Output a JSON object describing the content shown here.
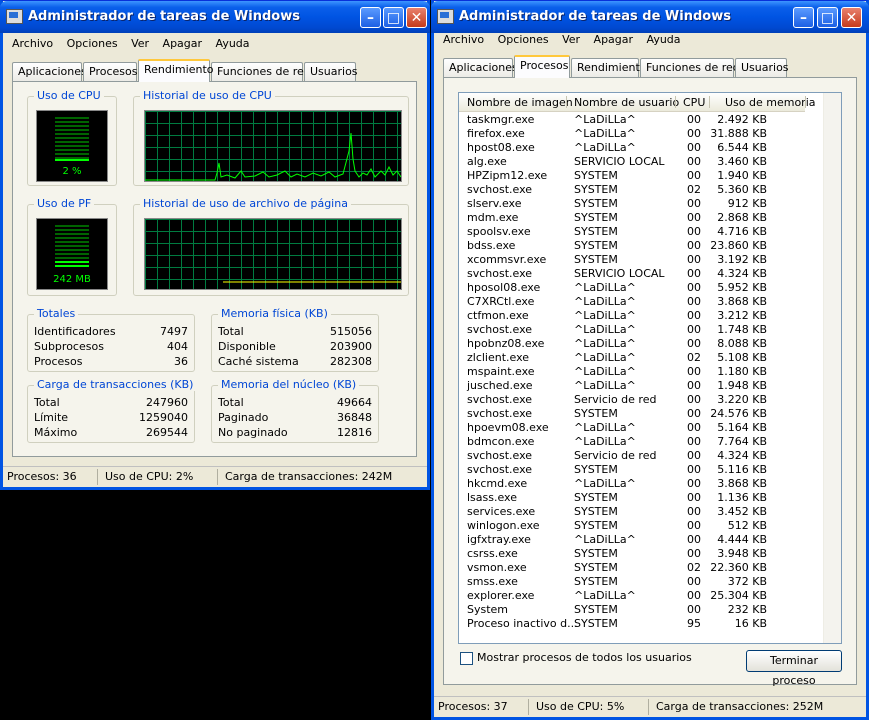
{
  "window1": {
    "title": "Administrador de tareas de Windows",
    "menu": [
      "Archivo",
      "Opciones",
      "Ver",
      "Apagar",
      "Ayuda"
    ],
    "tabs": [
      "Aplicaciones",
      "Procesos",
      "Rendimiento",
      "Funciones de red",
      "Usuarios"
    ],
    "active_tab": "Rendimiento",
    "cpu_usage": {
      "title": "Uso de CPU",
      "value": "2 %",
      "level": 0.02
    },
    "cpu_history": {
      "title": "Historial de uso de CPU"
    },
    "pf_usage": {
      "title": "Uso de PF",
      "value": "242 MB",
      "level": 0.19
    },
    "pf_history": {
      "title": "Historial de uso de archivo de página"
    },
    "totales": {
      "title": "Totales",
      "rows": [
        {
          "label": "Identificadores",
          "value": "7497"
        },
        {
          "label": "Subprocesos",
          "value": "404"
        },
        {
          "label": "Procesos",
          "value": "36"
        }
      ]
    },
    "memoria_fisica": {
      "title": "Memoria física (KB)",
      "rows": [
        {
          "label": "Total",
          "value": "515056"
        },
        {
          "label": "Disponible",
          "value": "203900"
        },
        {
          "label": "Caché sistema",
          "value": "282308"
        }
      ]
    },
    "carga_transacciones": {
      "title": "Carga de transacciones (KB)",
      "rows": [
        {
          "label": "Total",
          "value": "247960"
        },
        {
          "label": "Límite",
          "value": "1259040"
        },
        {
          "label": "Máximo",
          "value": "269544"
        }
      ]
    },
    "memoria_nucleo": {
      "title": "Memoria del núcleo (KB)",
      "rows": [
        {
          "label": "Total",
          "value": "49664"
        },
        {
          "label": "Paginado",
          "value": "36848"
        },
        {
          "label": "No paginado",
          "value": "12816"
        }
      ]
    },
    "status": {
      "procesos": "Procesos: 36",
      "cpu": "Uso de CPU: 2%",
      "carga": "Carga de transacciones: 242M"
    }
  },
  "window2": {
    "title": "Administrador de tareas de Windows",
    "menu": [
      "Archivo",
      "Opciones",
      "Ver",
      "Apagar",
      "Ayuda"
    ],
    "tabs": [
      "Aplicaciones",
      "Procesos",
      "Rendimiento",
      "Funciones de red",
      "Usuarios"
    ],
    "active_tab": "Procesos",
    "columns": [
      "Nombre de imagen",
      "Nombre de usuario",
      "CPU",
      "Uso de memoria"
    ],
    "processes": [
      [
        "taskmgr.exe",
        "^LaDiLLa^",
        "00",
        "2.492 KB"
      ],
      [
        "firefox.exe",
        "^LaDiLLa^",
        "00",
        "31.888 KB"
      ],
      [
        "hpost08.exe",
        "^LaDiLLa^",
        "00",
        "6.544 KB"
      ],
      [
        "alg.exe",
        "SERVICIO LOCAL",
        "00",
        "3.460 KB"
      ],
      [
        "HPZipm12.exe",
        "SYSTEM",
        "00",
        "1.940 KB"
      ],
      [
        "svchost.exe",
        "SYSTEM",
        "02",
        "5.360 KB"
      ],
      [
        "slserv.exe",
        "SYSTEM",
        "00",
        "912 KB"
      ],
      [
        "mdm.exe",
        "SYSTEM",
        "00",
        "2.868 KB"
      ],
      [
        "spoolsv.exe",
        "SYSTEM",
        "00",
        "4.716 KB"
      ],
      [
        "bdss.exe",
        "SYSTEM",
        "00",
        "23.860 KB"
      ],
      [
        "xcommsvr.exe",
        "SYSTEM",
        "00",
        "3.192 KB"
      ],
      [
        "svchost.exe",
        "SERVICIO LOCAL",
        "00",
        "4.324 KB"
      ],
      [
        "hposol08.exe",
        "^LaDiLLa^",
        "00",
        "5.952 KB"
      ],
      [
        "C7XRCtl.exe",
        "^LaDiLLa^",
        "00",
        "3.868 KB"
      ],
      [
        "ctfmon.exe",
        "^LaDiLLa^",
        "00",
        "3.212 KB"
      ],
      [
        "svchost.exe",
        "^LaDiLLa^",
        "00",
        "1.748 KB"
      ],
      [
        "hpobnz08.exe",
        "^LaDiLLa^",
        "00",
        "8.088 KB"
      ],
      [
        "zlclient.exe",
        "^LaDiLLa^",
        "02",
        "5.108 KB"
      ],
      [
        "mspaint.exe",
        "^LaDiLLa^",
        "00",
        "1.180 KB"
      ],
      [
        "jusched.exe",
        "^LaDiLLa^",
        "00",
        "1.948 KB"
      ],
      [
        "svchost.exe",
        "Servicio de red",
        "00",
        "3.220 KB"
      ],
      [
        "svchost.exe",
        "SYSTEM",
        "00",
        "24.576 KB"
      ],
      [
        "hpoevm08.exe",
        "^LaDiLLa^",
        "00",
        "5.164 KB"
      ],
      [
        "bdmcon.exe",
        "^LaDiLLa^",
        "00",
        "7.764 KB"
      ],
      [
        "svchost.exe",
        "Servicio de red",
        "00",
        "4.324 KB"
      ],
      [
        "svchost.exe",
        "SYSTEM",
        "00",
        "5.116 KB"
      ],
      [
        "hkcmd.exe",
        "^LaDiLLa^",
        "00",
        "3.868 KB"
      ],
      [
        "lsass.exe",
        "SYSTEM",
        "00",
        "1.136 KB"
      ],
      [
        "services.exe",
        "SYSTEM",
        "00",
        "3.452 KB"
      ],
      [
        "winlogon.exe",
        "SYSTEM",
        "00",
        "512 KB"
      ],
      [
        "igfxtray.exe",
        "^LaDiLLa^",
        "00",
        "4.444 KB"
      ],
      [
        "csrss.exe",
        "SYSTEM",
        "00",
        "3.948 KB"
      ],
      [
        "vsmon.exe",
        "SYSTEM",
        "02",
        "22.360 KB"
      ],
      [
        "smss.exe",
        "SYSTEM",
        "00",
        "372 KB"
      ],
      [
        "explorer.exe",
        "^LaDiLLa^",
        "00",
        "25.304 KB"
      ],
      [
        "System",
        "SYSTEM",
        "00",
        "232 KB"
      ],
      [
        "Proceso inactivo d...",
        "SYSTEM",
        "95",
        "16 KB"
      ]
    ],
    "show_all_label": "Mostrar procesos de todos los usuarios",
    "end_process_label": "Terminar proceso",
    "status": {
      "procesos": "Procesos: 37",
      "cpu": "Uso de CPU: 5%",
      "carga": "Carga de transacciones: 252M"
    }
  }
}
